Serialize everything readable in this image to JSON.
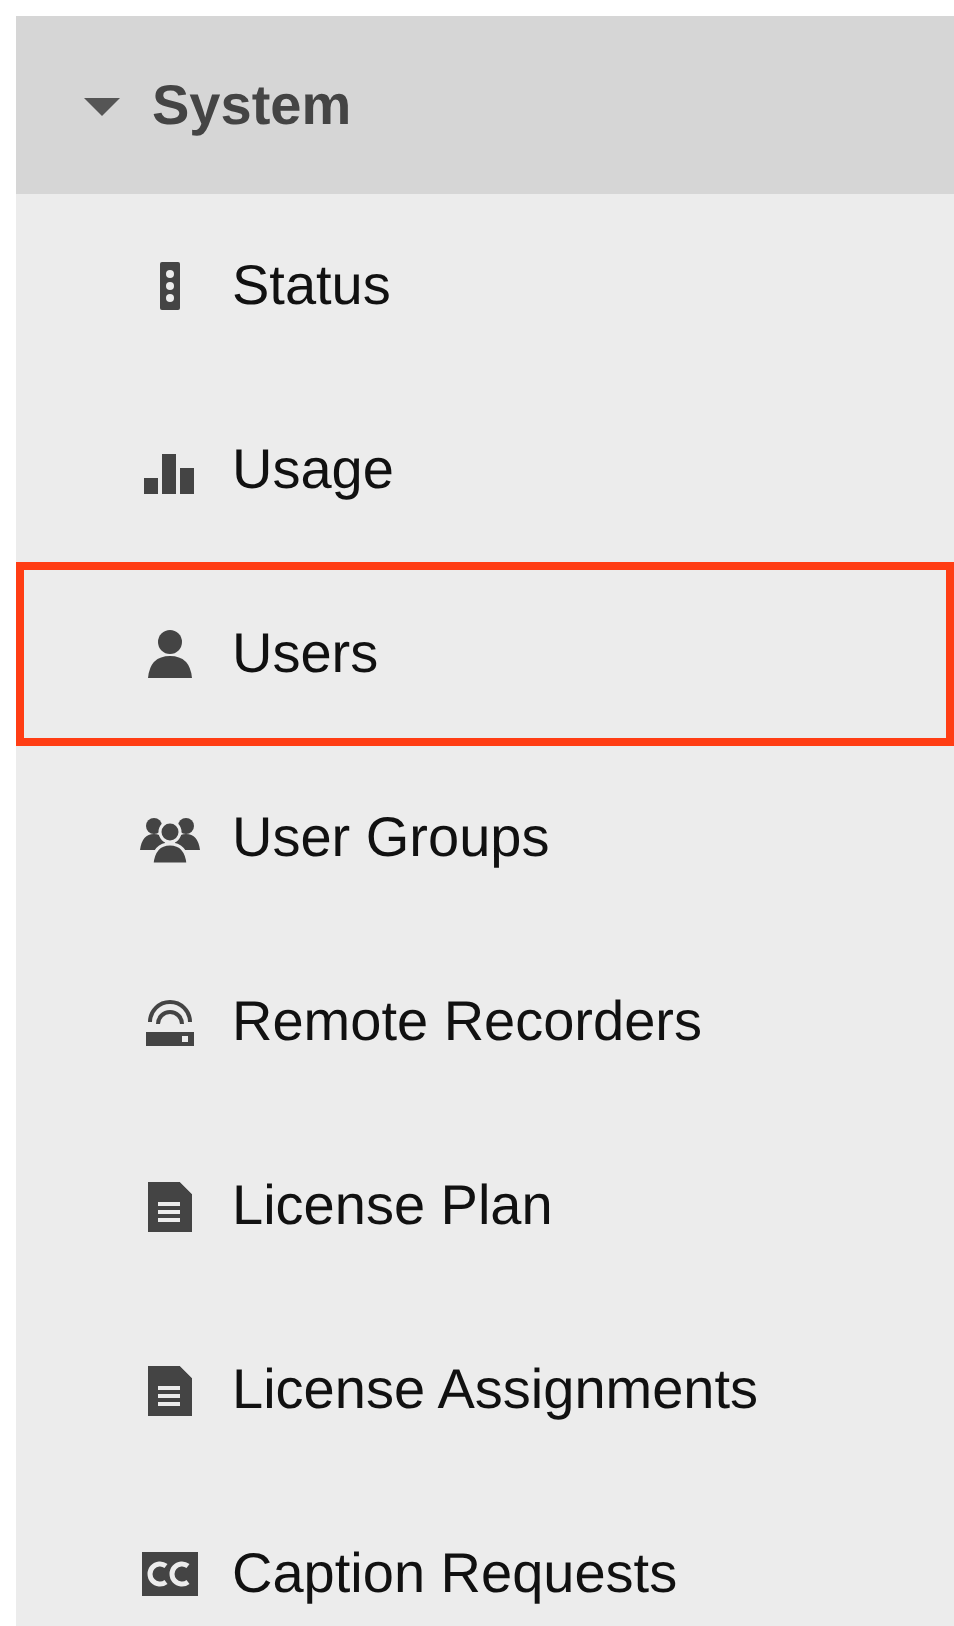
{
  "section": {
    "title": "System",
    "expanded": true
  },
  "items": [
    {
      "label": "Status",
      "kind": "status",
      "selected": false
    },
    {
      "label": "Usage",
      "kind": "usage",
      "selected": false
    },
    {
      "label": "Users",
      "kind": "user",
      "selected": true
    },
    {
      "label": "User Groups",
      "kind": "group",
      "selected": false
    },
    {
      "label": "Remote Recorders",
      "kind": "recorder",
      "selected": false
    },
    {
      "label": "License Plan",
      "kind": "document",
      "selected": false
    },
    {
      "label": "License Assignments",
      "kind": "document",
      "selected": false
    },
    {
      "label": "Caption Requests",
      "kind": "caption",
      "selected": false
    }
  ]
}
